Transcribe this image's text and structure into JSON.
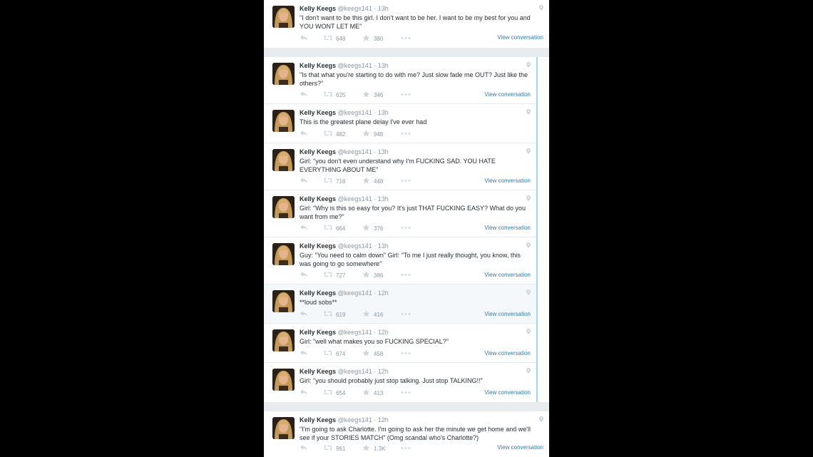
{
  "tweets": [
    {
      "name": "Kelly Keegs",
      "handle": "@keegs141",
      "time": "13h",
      "text": "\"I don't want to be this girl. I don't want to be her. I want to be my best for you and YOU WONT LET ME\"",
      "retweets": "648",
      "favorites": "380",
      "view": "View conversation"
    },
    {
      "name": "Kelly Keegs",
      "handle": "@keegs141",
      "time": "13h",
      "text": "\"Is that what you're starting to do with me? Just slow fade me OUT? Just like the others?\"",
      "retweets": "625",
      "favorites": "346",
      "view": "View conversation"
    },
    {
      "name": "Kelly Keegs",
      "handle": "@keegs141",
      "time": "13h",
      "text": "This is the greatest plane delay I've ever had",
      "retweets": "482",
      "favorites": "948",
      "view": ""
    },
    {
      "name": "Kelly Keegs",
      "handle": "@keegs141",
      "time": "13h",
      "text": "Girl: \"you don't even understand why I'm FUCKING SAD. YOU HATE EVERYTHING ABOUT ME\"",
      "retweets": "718",
      "favorites": "448",
      "view": "View conversation"
    },
    {
      "name": "Kelly Keegs",
      "handle": "@keegs141",
      "time": "13h",
      "text": "Girl: \"Why is this so easy for you? It's just THAT FUCKING EASY? What do you want from me?\"",
      "retweets": "664",
      "favorites": "376",
      "view": "View conversation"
    },
    {
      "name": "Kelly Keegs",
      "handle": "@keegs141",
      "time": "13h",
      "text": "Guy: \"You need to calm down\" Girl: \"To me I just really thought, you know, this was going to go somewhere\"",
      "retweets": "727",
      "favorites": "386",
      "view": "View conversation"
    },
    {
      "name": "Kelly Keegs",
      "handle": "@keegs141",
      "time": "12h",
      "text": "**loud sobs**",
      "retweets": "619",
      "favorites": "416",
      "view": "View conversation"
    },
    {
      "name": "Kelly Keegs",
      "handle": "@keegs141",
      "time": "12h",
      "text": "Girl: \"well what makes you so FUCKING SPECIAL?\"",
      "retweets": "674",
      "favorites": "458",
      "view": "View conversation"
    },
    {
      "name": "Kelly Keegs",
      "handle": "@keegs141",
      "time": "12h",
      "text": "Girl: \"you should probably just stop talking. Just stop TALKING!!\"",
      "retweets": "654",
      "favorites": "413",
      "view": "View conversation"
    },
    {
      "name": "Kelly Keegs",
      "handle": "@keegs141",
      "time": "12h",
      "text": "\"I'm going to ask Charlotte. I'm going to ask her the minute we get home and we'll see if your STORIES MATCH\" (Omg scandal who's Charlotte?)",
      "retweets": "961",
      "favorites": "1.3K",
      "view": "View conversation"
    }
  ],
  "icons": {
    "reply": "reply-icon",
    "retweet": "retweet-icon",
    "favorite": "star-icon",
    "more": "more-icon",
    "geo": "location-pin-icon"
  },
  "colors": {
    "link": "#2b7bb9",
    "muted": "#8899a6",
    "text": "#292f33",
    "thread_line": "#9fd4f3",
    "highlight": "#f5f8fa"
  }
}
